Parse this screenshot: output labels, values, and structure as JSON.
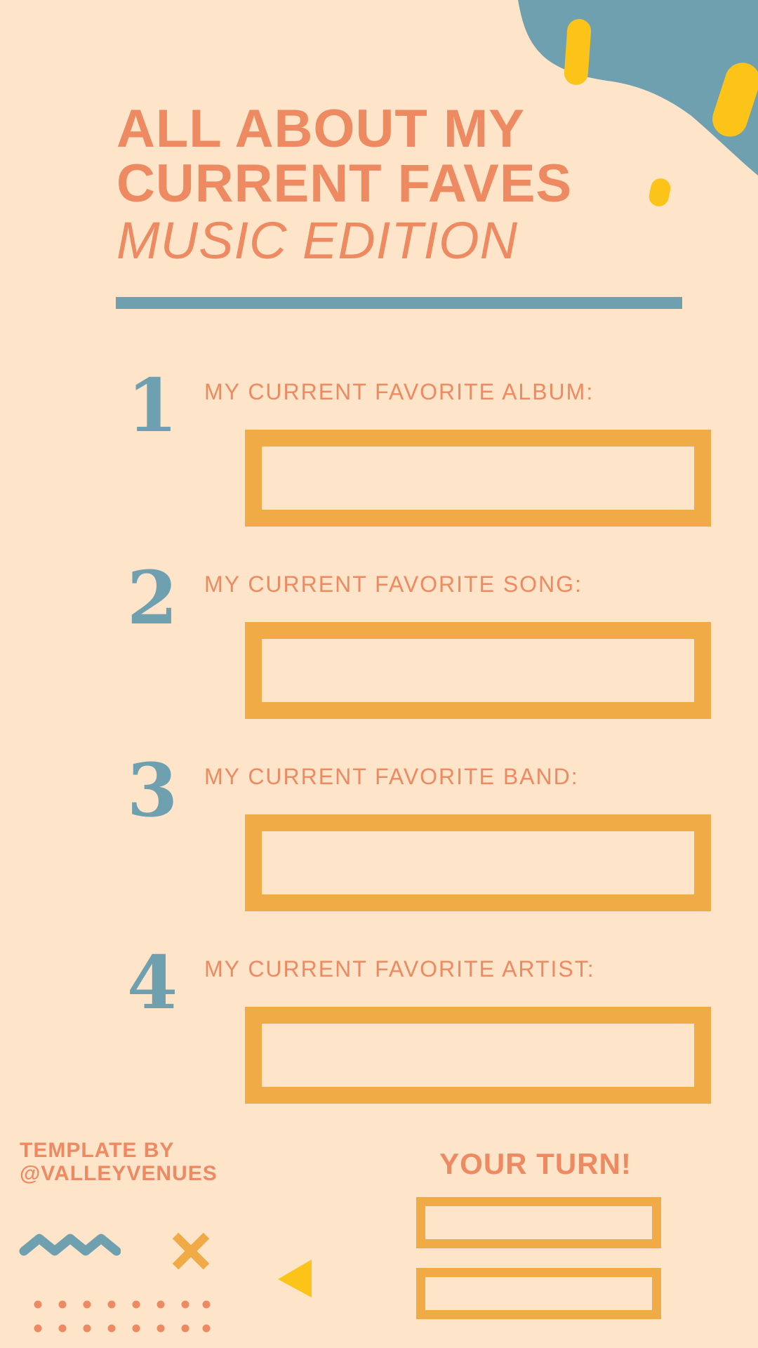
{
  "title": {
    "line1": "ALL ABOUT MY",
    "line2": "CURRENT FAVES",
    "subtitle": "MUSIC EDITION"
  },
  "prompts": [
    {
      "number": "1",
      "label": "MY CURRENT FAVORITE ALBUM:"
    },
    {
      "number": "2",
      "label": "MY CURRENT FAVORITE SONG:"
    },
    {
      "number": "3",
      "label": "MY CURRENT FAVORITE BAND:"
    },
    {
      "number": "4",
      "label": "MY CURRENT FAVORITE ARTIST:"
    }
  ],
  "footer": {
    "credit_line1": "TEMPLATE BY",
    "credit_line2": "@VALLEYVENUES",
    "your_turn": "YOUR TURN!"
  },
  "colors": {
    "background": "#FEE4C8",
    "accent_orange": "#EE8A62",
    "box_orange": "#F0AA46",
    "blue": "#6FA0B0",
    "yellow": "#FCC419"
  },
  "icons": [
    "blob-shape",
    "zigzag-icon",
    "cross-icon",
    "triangle-icon",
    "dot-grid-icon"
  ]
}
